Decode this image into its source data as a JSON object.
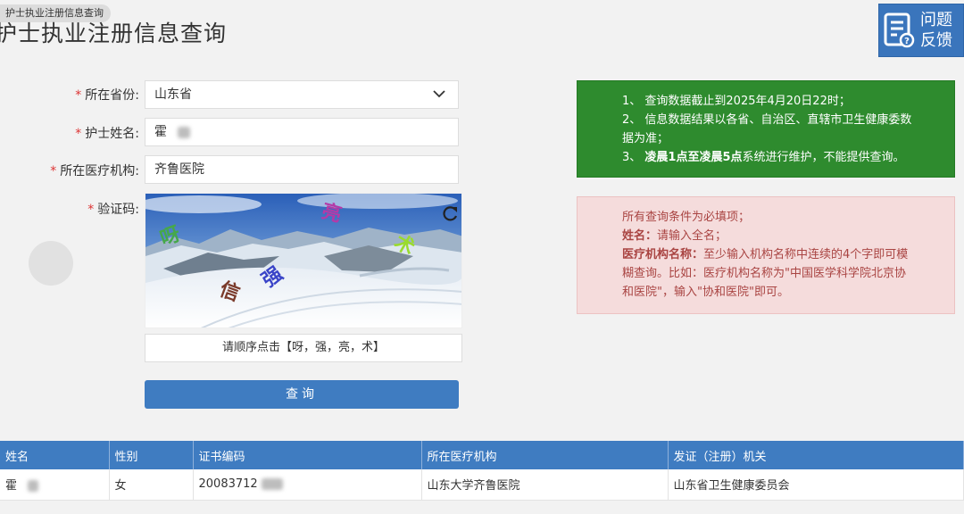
{
  "tab": {
    "label": "护士执业注册信息查询"
  },
  "page": {
    "title": "护士执业注册信息查询"
  },
  "feedback": {
    "line1": "问题",
    "line2": "反馈"
  },
  "form": {
    "province": {
      "label": "所在省份:",
      "value": "山东省"
    },
    "name": {
      "label": "护士姓名:",
      "value": "霍"
    },
    "institution": {
      "label": "所在医疗机构:",
      "value": "齐鲁医院"
    },
    "captcha": {
      "label": "验证码:",
      "chars": [
        "呀",
        "亮",
        "术",
        "强",
        "信"
      ],
      "hint": "请顺序点击【呀，强，亮，术】"
    },
    "submit_label": "查询"
  },
  "notice_green": {
    "item1": "1、  查询数据截止到2025年4月20日22时；",
    "item2a": "2、  信息数据结果以各省、自治区、直辖市卫生健康委数",
    "item2b": "据为准；",
    "item3_prefix": "3、  ",
    "item3_bold": "凌晨1点至凌晨5点",
    "item3_rest": "系统进行维护，不能提供查询。"
  },
  "notice_red": {
    "line1": "所有查询条件为必填项；",
    "name_bold": "姓名：",
    "name_text": "请输入全名；",
    "inst_bold": "医疗机构名称：",
    "inst_text": "至少输入机构名称中连续的4个字即可模",
    "line4": "糊查询。比如：医疗机构名称为\"中国医学科学院北京协",
    "line5": "和医院\"，输入\"协和医院\"即可。"
  },
  "results": {
    "headers": [
      "姓名",
      "性别",
      "证书编码",
      "所在医疗机构",
      "发证（注册）机关"
    ],
    "rows": [
      {
        "name": "霍",
        "gender": "女",
        "cert": "20083712",
        "institution": "山东大学齐鲁医院",
        "authority": "山东省卫生健康委员会"
      }
    ]
  },
  "colors": {
    "primary": "#3f7cc1",
    "green": "#2e8b2e",
    "danger_bg": "#f5dcdc",
    "danger_text": "#a94442"
  }
}
